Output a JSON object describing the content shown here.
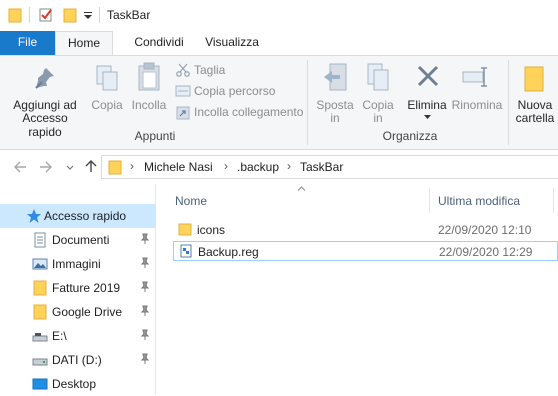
{
  "window": {
    "title": "TaskBar"
  },
  "tabs": [
    {
      "label": "File"
    },
    {
      "label": "Home"
    },
    {
      "label": "Condividi"
    },
    {
      "label": "Visualizza"
    }
  ],
  "ribbon": {
    "appunti": {
      "group_label": "Appunti",
      "pin_line1": "Aggiungi ad",
      "pin_line2": "Accesso rapido",
      "copy": "Copia",
      "paste": "Incolla",
      "cut": "Taglia",
      "copy_path": "Copia percorso",
      "paste_shortcut": "Incolla collegamento"
    },
    "organizza": {
      "group_label": "Organizza",
      "move_line1": "Sposta",
      "move_line2": "in",
      "copyto_line1": "Copia",
      "copyto_line2": "in",
      "delete": "Elimina",
      "rename": "Rinomina"
    },
    "nuovo": {
      "new_line1": "Nuova",
      "new_line2": "cartella"
    }
  },
  "address": {
    "crumbs": [
      "Michele Nasi",
      ".backup",
      "TaskBar"
    ]
  },
  "nav": {
    "items": [
      {
        "label": "Accesso rapido",
        "icon": "star-icon",
        "selected": true
      },
      {
        "label": "Documenti",
        "icon": "documents-icon",
        "pinned": true
      },
      {
        "label": "Immagini",
        "icon": "pictures-icon",
        "pinned": true
      },
      {
        "label": "Fatture 2019",
        "icon": "folder-icon",
        "pinned": true
      },
      {
        "label": "Google Drive",
        "icon": "folder-icon",
        "pinned": true
      },
      {
        "label": "E:\\",
        "icon": "drive-icon",
        "pinned": true
      },
      {
        "label": "DATI (D:)",
        "icon": "drive-icon",
        "pinned": true
      },
      {
        "label": "Desktop",
        "icon": "desktop-icon"
      }
    ]
  },
  "files": {
    "columns": {
      "name": "Nome",
      "modified": "Ultima modifica"
    },
    "rows": [
      {
        "name": "icons",
        "modified": "22/09/2020 12:10",
        "icon": "folder-icon"
      },
      {
        "name": "Backup.reg",
        "modified": "22/09/2020 12:29",
        "icon": "registry-file-icon",
        "selected": true
      }
    ]
  },
  "colors": {
    "accent": "#1979ca",
    "selection": "#cce8ff",
    "folder": "#ffd35a"
  }
}
